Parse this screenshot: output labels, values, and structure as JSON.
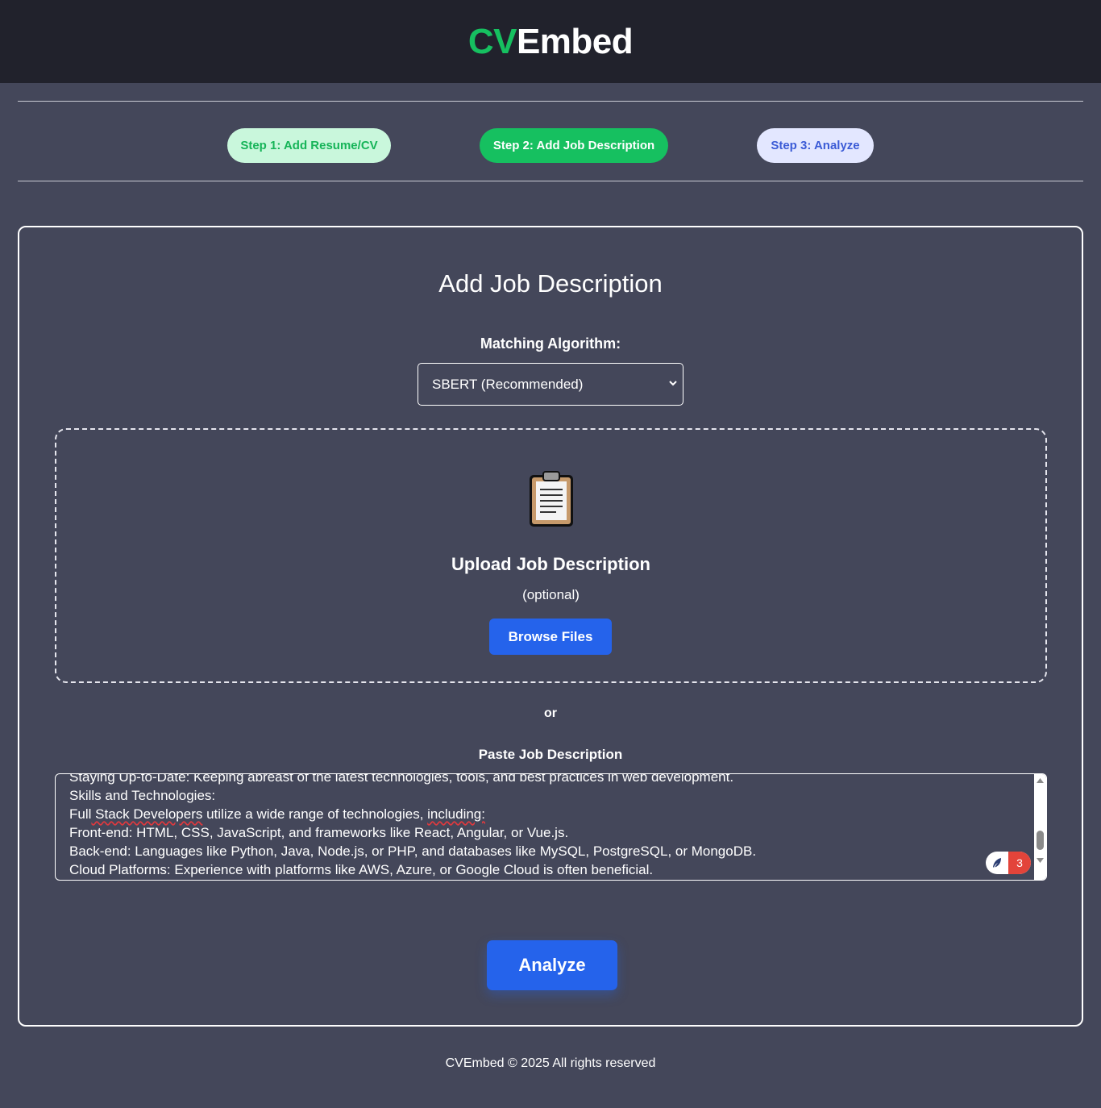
{
  "header": {
    "brand_prefix": "CV",
    "brand_suffix": "Embed"
  },
  "steps": [
    {
      "label": "Step 1: Add Resume/CV"
    },
    {
      "label": "Step 2: Add Job Description"
    },
    {
      "label": "Step 3: Analyze"
    }
  ],
  "card": {
    "title": "Add Job Description",
    "algorithm_label": "Matching Algorithm:",
    "algorithm_selected": "SBERT (Recommended)"
  },
  "upload": {
    "icon": "clipboard-icon",
    "title": "Upload Job Description",
    "subtitle": "(optional)",
    "browse_label": "Browse Files"
  },
  "divider_text": "or",
  "paste": {
    "label": "Paste Job Description",
    "lines": [
      "Staying Up-to-Date: Keeping abreast of the latest technologies, tools, and best practices in web development.",
      "Skills and Technologies:",
      "Full Stack Developers utilize a wide range of technologies, including:",
      "Front-end: HTML, CSS, JavaScript, and frameworks like React, Angular, or Vue.js.",
      "Back-end: Languages like Python, Java, Node.js, or PHP, and databases like MySQL, PostgreSQL, or MongoDB.",
      "Cloud Platforms: Experience with platforms like AWS, Azure, or Google Cloud is often beneficial."
    ],
    "line3_parts": [
      "Full",
      " Stack Developers",
      " utilize a wide range of technologies, ",
      "including:"
    ],
    "grammar_count": "3"
  },
  "analyze_label": "Analyze",
  "footer": "CVEmbed © 2025 All rights reserved",
  "colors": {
    "accent_green": "#16c060",
    "primary_blue": "#2563eb",
    "background": "#44475a",
    "topbar": "#21222c"
  }
}
